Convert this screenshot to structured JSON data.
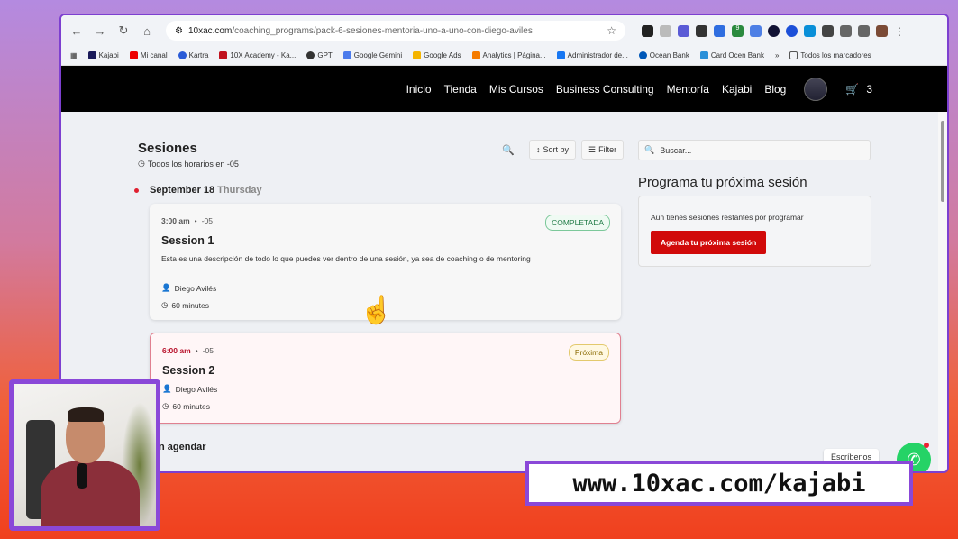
{
  "browser": {
    "url_host": "10xac.com",
    "url_path": "/coaching_programs/pack-6-sesiones-mentoria-uno-a-uno-con-diego-aviles",
    "bookmarks": [
      "Kajabi",
      "Mi canal",
      "Kartra",
      "10X Academy - Ka...",
      "GPT",
      "Google Gemini",
      "Google Ads",
      "Analytics | Página...",
      "Administrador de...",
      "Ocean Bank",
      "Card Ocen Bank"
    ],
    "bookmarks_more": "»",
    "bookmarks_folder": "Todos los marcadores",
    "ext_badge": "9"
  },
  "site_nav": {
    "items": [
      "Inicio",
      "Tienda",
      "Mis Cursos",
      "Business Consulting",
      "Mentoría",
      "Kajabi",
      "Blog"
    ],
    "cart_count": "3"
  },
  "sessions": {
    "heading": "Sesiones",
    "timezone": "Todos los horarios en -05",
    "sort_label": "Sort by",
    "filter_label": "Filter",
    "date_label": "September 18",
    "day_label": "Thursday",
    "items": [
      {
        "time": "3:00 am",
        "tz": "-05",
        "badge": "COMPLETADA",
        "title": "Session 1",
        "description": "Esta es una descripción de todo lo que puedes ver dentro de una sesión, ya sea de coaching o de mentoring",
        "coach": "Diego Avilés",
        "duration": "60 minutes"
      },
      {
        "time": "6:00 am",
        "tz": "-05",
        "badge": "Próxima",
        "title": "Session 2",
        "coach": "Diego Avilés",
        "duration": "60 minutes"
      }
    ],
    "unscheduled_heading": "n agendar"
  },
  "sidebar": {
    "search_placeholder": "Buscar...",
    "heading": "Programa tu próxima sesión",
    "remaining_text": "Aún tienes sesiones restantes por programar",
    "cta_label": "Agenda tu próxima sesión"
  },
  "chat": {
    "label": "Escríbenos"
  },
  "overlay": {
    "promo_url": "www.10xac.com/kajabi"
  }
}
